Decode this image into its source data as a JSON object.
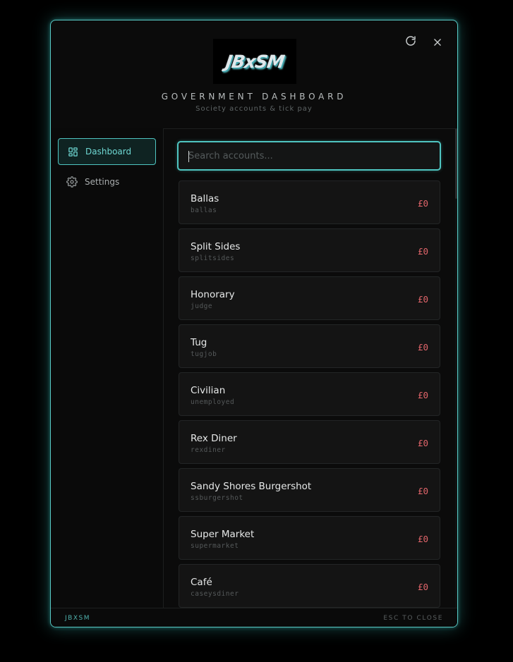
{
  "header": {
    "logo_text": "JBxSM",
    "title": "GOVERNMENT DASHBOARD",
    "subtitle": "Society accounts & tick pay"
  },
  "sidebar": {
    "items": [
      {
        "label": "Dashboard",
        "icon": "dashboard-icon",
        "active": true
      },
      {
        "label": "Settings",
        "icon": "gear-icon",
        "active": false
      }
    ]
  },
  "search": {
    "placeholder": "Search accounts...",
    "value": ""
  },
  "accounts": [
    {
      "name": "Ballas",
      "id": "ballas",
      "balance": "£0"
    },
    {
      "name": "Split Sides",
      "id": "splitsides",
      "balance": "£0"
    },
    {
      "name": "Honorary",
      "id": "judge",
      "balance": "£0"
    },
    {
      "name": "Tug",
      "id": "tugjob",
      "balance": "£0"
    },
    {
      "name": "Civilian",
      "id": "unemployed",
      "balance": "£0"
    },
    {
      "name": "Rex Diner",
      "id": "rexdiner",
      "balance": "£0"
    },
    {
      "name": "Sandy Shores Burgershot",
      "id": "ssburgershot",
      "balance": "£0"
    },
    {
      "name": "Super Market",
      "id": "supermarket",
      "balance": "£0"
    },
    {
      "name": "Café",
      "id": "caseysdiner",
      "balance": "£0"
    }
  ],
  "footer": {
    "brand": "JBXSM",
    "hint": "ESC TO CLOSE"
  },
  "colors": {
    "accent": "#4fc5c1",
    "balance": "#e0656a",
    "background": "#0b0b0b"
  }
}
